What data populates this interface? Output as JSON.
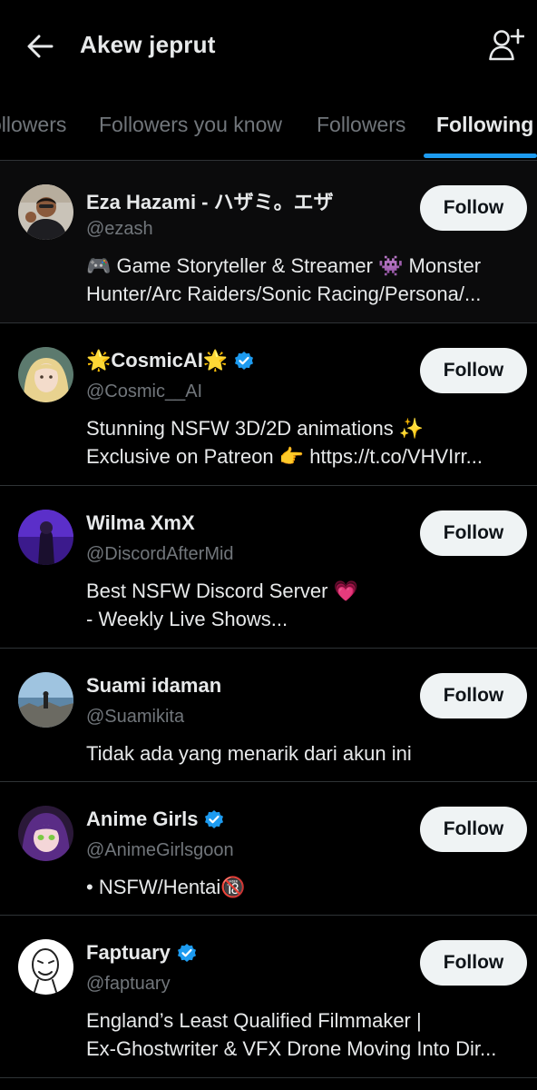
{
  "header": {
    "title": "Akew jeprut",
    "back_icon": "arrow-left-icon",
    "add_icon": "add-user-icon"
  },
  "tabs": [
    {
      "label": "ollowers",
      "active": false
    },
    {
      "label": "Followers you know",
      "active": false
    },
    {
      "label": "Followers",
      "active": false
    },
    {
      "label": "Following",
      "active": true
    }
  ],
  "colors": {
    "background": "#000000",
    "accent": "#1d9bf0",
    "text": "#e7e9ea",
    "muted": "#71767b",
    "button_bg": "#eff3f4"
  },
  "users": [
    {
      "name": "Eza Hazami - ハザミ。エザ",
      "handle": "@ezash",
      "verified": false,
      "follow_label": "Follow",
      "bio": [
        "🎮 Game Storyteller & Streamer 👾 Monster",
        "Hunter/Arc Raiders/Sonic Racing/Persona/..."
      ]
    },
    {
      "name": "🌟CosmicAI🌟",
      "handle": "@Cosmic__AI",
      "verified": true,
      "follow_label": "Follow",
      "bio": [
        "Stunning NSFW 3D/2D animations ✨",
        "Exclusive on Patreon 👉 https://t.co/VHVIrr..."
      ]
    },
    {
      "name": "Wilma XmX",
      "handle": "@DiscordAfterMid",
      "verified": false,
      "follow_label": "Follow",
      "bio": [
        "Best NSFW Discord Server 💗",
        "- Weekly Live Shows..."
      ]
    },
    {
      "name": "Suami idaman",
      "handle": "@Suamikita",
      "verified": false,
      "follow_label": "Follow",
      "bio": [
        "Tidak ada yang menarik dari akun ini"
      ]
    },
    {
      "name": "Anime Girls",
      "handle": "@AnimeGirlsgoon",
      "verified": true,
      "follow_label": "Follow",
      "bio": [
        "• NSFW/Hentai🔞"
      ]
    },
    {
      "name": "Faptuary",
      "handle": "@faptuary",
      "verified": true,
      "follow_label": "Follow",
      "bio": [
        "England’s Least Qualified Filmmaker |",
        "Ex-Ghostwriter & VFX Drone Moving Into Dir..."
      ]
    }
  ]
}
